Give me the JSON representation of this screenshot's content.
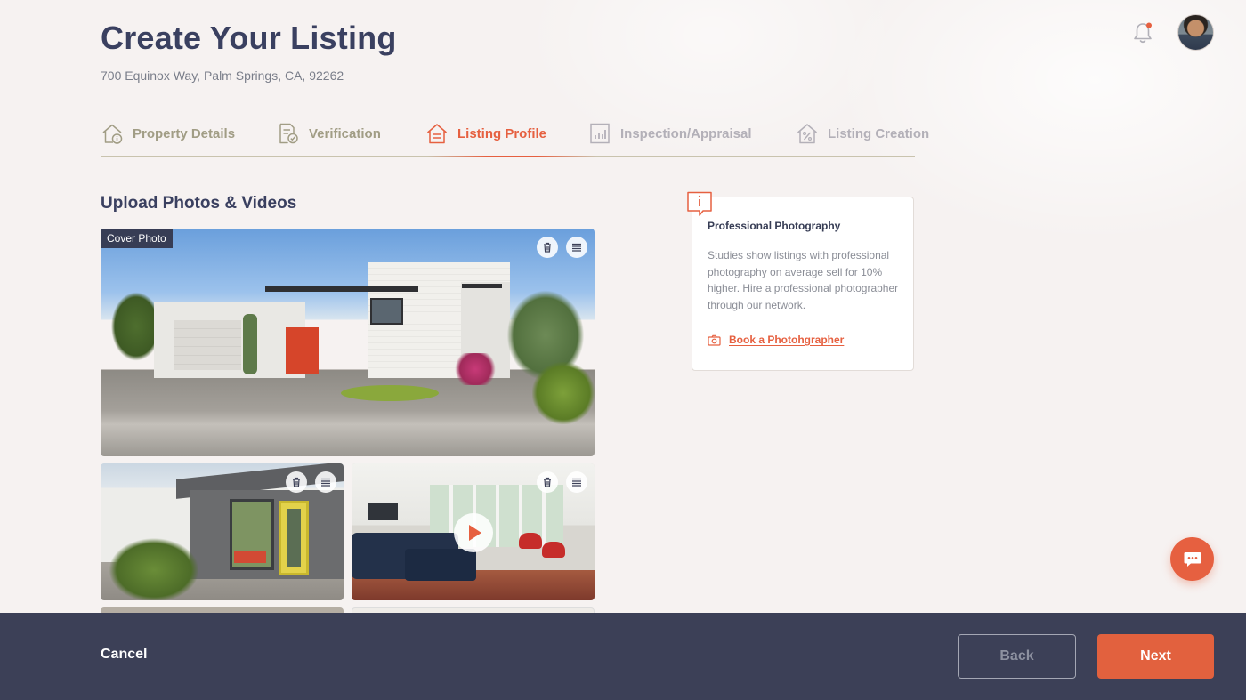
{
  "header": {
    "title": "Create Your Listing",
    "address": "700 Equinox Way, Palm Springs, CA, 92262"
  },
  "steps": [
    {
      "label": "Property Details",
      "state": "complete",
      "icon": "house-info-icon"
    },
    {
      "label": "Verification",
      "state": "complete",
      "icon": "document-check-icon"
    },
    {
      "label": "Listing Profile",
      "state": "active",
      "icon": "house-list-icon"
    },
    {
      "label": "Inspection/Appraisal",
      "state": "pending",
      "icon": "chart-document-icon"
    },
    {
      "label": "Listing Creation",
      "state": "pending",
      "icon": "house-percent-icon"
    }
  ],
  "upload": {
    "title": "Upload Photos & Videos",
    "cover_label": "Cover Photo"
  },
  "photos": [
    {
      "type": "photo",
      "subject": "house-exterior",
      "cover": true
    },
    {
      "type": "photo",
      "subject": "front-porch",
      "cover": false
    },
    {
      "type": "video",
      "subject": "living-room",
      "cover": false
    }
  ],
  "tip_card": {
    "title": "Professional Photography",
    "text": "Studies show listings with professional photography on average sell for 10% higher. Hire a professional photographer through our network.",
    "link_label": "Book a Photohgrapher",
    "icon": "info-speech-icon",
    "link_icon": "camera-icon"
  },
  "footer": {
    "cancel_label": "Cancel",
    "back_label": "Back",
    "next_label": "Next"
  },
  "colors": {
    "accent": "#e66040",
    "navy": "#3c4057",
    "step_complete": "#a19d85",
    "step_pending": "#b3b0b8",
    "background": "#f6f2f1"
  }
}
